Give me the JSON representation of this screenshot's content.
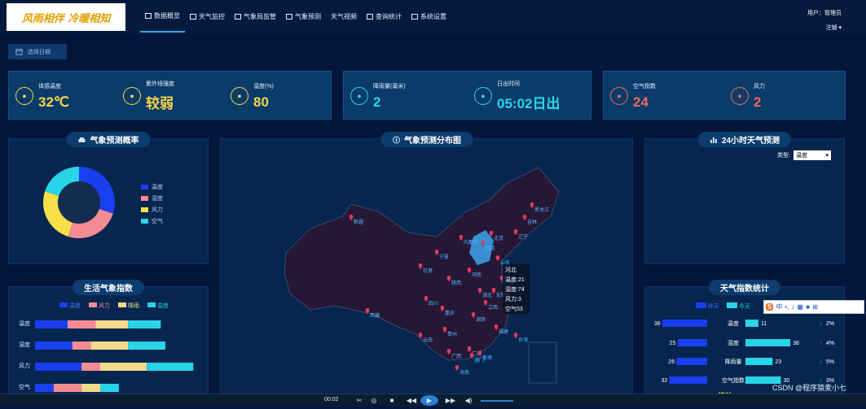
{
  "header": {
    "logo_text": "风雨相伴 冷暖相知",
    "nav": [
      {
        "label": "数据概览",
        "icon": "monitor-icon",
        "active": true
      },
      {
        "label": "天气监控",
        "icon": "truck-icon",
        "active": false
      },
      {
        "label": "气象局监管",
        "icon": "bank-icon",
        "active": false
      },
      {
        "label": "气象预测",
        "icon": "chart-box-icon",
        "active": false
      },
      {
        "label": "天气视频",
        "icon": "none",
        "active": false
      },
      {
        "label": "查询统计",
        "icon": "bar-chart-icon",
        "active": false
      },
      {
        "label": "系统设置",
        "icon": "gear-icon",
        "active": false
      }
    ],
    "user_label": "用户：管理员",
    "logout_label": "注销"
  },
  "date_button": {
    "label": "选择日期"
  },
  "kpis": [
    {
      "label": "体感温度",
      "value": "32℃",
      "color": "#f6d44a",
      "icon": "car-icon"
    },
    {
      "label": "紫外线强度",
      "value": "较弱",
      "color": "#f6d44a",
      "icon": "upload-icon"
    },
    {
      "label": "湿度(%)",
      "value": "80",
      "color": "#f6d44a",
      "icon": "clock-icon"
    },
    {
      "label": "降雨量(毫米)",
      "value": "2",
      "color": "#27d6ea",
      "icon": "timer-icon"
    },
    {
      "label": "日出时间",
      "value": "05:02日出",
      "color": "#27d6ea",
      "icon": "scale-icon"
    },
    {
      "label": "空气指数",
      "value": "24",
      "color": "#f06a5c",
      "icon": "hourglass-icon"
    },
    {
      "label": "风力",
      "value": "2",
      "color": "#f06a5c",
      "icon": "scale-icon"
    }
  ],
  "panels": {
    "forecast_prob": {
      "title": "气象预测概率",
      "legend": [
        "温度",
        "湿度",
        "风力",
        "空气"
      ]
    },
    "map": {
      "title": "气象预测分布图"
    },
    "hourly": {
      "title": "24小时天气预测",
      "type_label": "类型:",
      "type_value": "温度"
    },
    "life_index": {
      "title": "生活气象指数"
    },
    "weather_stats": {
      "title": "天气指数统计"
    }
  },
  "map_labels": [
    "新疆",
    "西藏",
    "甘肃",
    "宁夏",
    "内蒙古",
    "陕西",
    "四川",
    "重庆",
    "贵州",
    "云南",
    "广西",
    "广东",
    "海南",
    "湖南",
    "湖北",
    "河南",
    "河北",
    "北京",
    "山东",
    "江苏",
    "安徽",
    "江西",
    "浙江",
    "福建",
    "台湾",
    "上海",
    "辽宁",
    "吉林",
    "黑龙江",
    "澳门",
    "香港"
  ],
  "tooltip": {
    "lines": [
      "河北",
      "温度:21",
      "湿度:74",
      "风力:3",
      "空气53"
    ]
  },
  "chart_data": [
    {
      "type": "pie",
      "title": "气象预测概率",
      "categories": [
        "温度",
        "湿度",
        "风力",
        "空气"
      ],
      "values": [
        30,
        25,
        25,
        20
      ],
      "colors": [
        "#1a3ff0",
        "#f38b95",
        "#f6e04a",
        "#29d4e6"
      ]
    },
    {
      "type": "bar",
      "title": "生活气象指数",
      "orientation": "horizontal",
      "stacked": true,
      "categories": [
        "温度",
        "湿度",
        "风力",
        "空气"
      ],
      "series": [
        {
          "name": "温度",
          "values": [
            7,
            8,
            10,
            4
          ],
          "color": "#1a3ff0"
        },
        {
          "name": "风力",
          "values": [
            6,
            4,
            4,
            6
          ],
          "color": "#f38b95"
        },
        {
          "name": "降雨",
          "values": [
            7,
            8,
            10,
            4
          ],
          "color": "#f3d98c"
        },
        {
          "name": "湿度",
          "values": [
            7,
            8,
            10,
            4
          ],
          "color": "#29d4e6"
        }
      ],
      "xticks": [
        0,
        5,
        10,
        15,
        20,
        25,
        30,
        35
      ],
      "xlim": [
        0,
        35
      ]
    },
    {
      "type": "bar",
      "title": "天气指数统计",
      "orientation": "horizontal",
      "categories": [
        "温度",
        "湿度",
        "降雨量",
        "空气指数"
      ],
      "series": [
        {
          "name": "昨天",
          "values": [
            38,
            25,
            26,
            32
          ],
          "color": "#1a3ff0"
        },
        {
          "name": "今天",
          "values": [
            11,
            38,
            23,
            30
          ],
          "color": "#29d4e6"
        }
      ],
      "changes": [
        {
          "dir": "down",
          "value": "2%"
        },
        {
          "dir": "up",
          "value": "4%"
        },
        {
          "dir": "down",
          "value": "5%"
        },
        {
          "dir": "down",
          "value": "3%"
        }
      ],
      "footer": {
        "left": "80",
        "mid": "统计",
        "right": "70"
      }
    }
  ],
  "player": {
    "time": "00:02"
  },
  "watermark": "CSDN @程序猿麦小七",
  "ime": {
    "label": "中"
  }
}
